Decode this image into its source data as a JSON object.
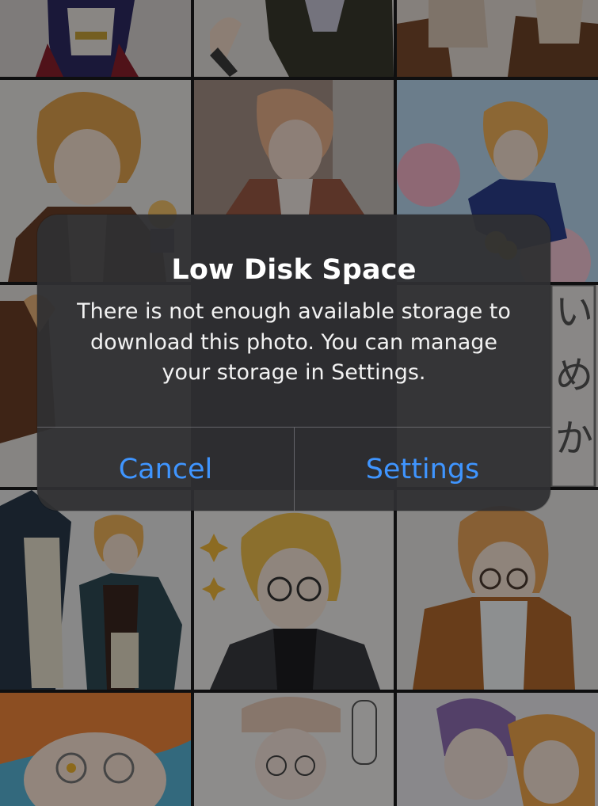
{
  "alert": {
    "title": "Low Disk Space",
    "message": "There is not enough available storage to download this photo. You can manage your storage in Settings.",
    "cancel_label": "Cancel",
    "settings_label": "Settings"
  },
  "colors": {
    "accent": "#3f95ff",
    "alert_background": "#303032",
    "separator": "#78787d"
  },
  "photo_grid": {
    "thumbnails": [
      {
        "label": ""
      },
      {
        "label": ""
      },
      {
        "label": ""
      },
      {
        "label": ""
      },
      {
        "label": ""
      },
      {
        "label": ""
      },
      {
        "label": ""
      },
      {
        "label": ""
      },
      {
        "label": ""
      },
      {
        "label": ""
      },
      {
        "label": ""
      },
      {
        "label": ""
      },
      {
        "label": ""
      },
      {
        "label": ""
      },
      {
        "label": ""
      }
    ]
  }
}
